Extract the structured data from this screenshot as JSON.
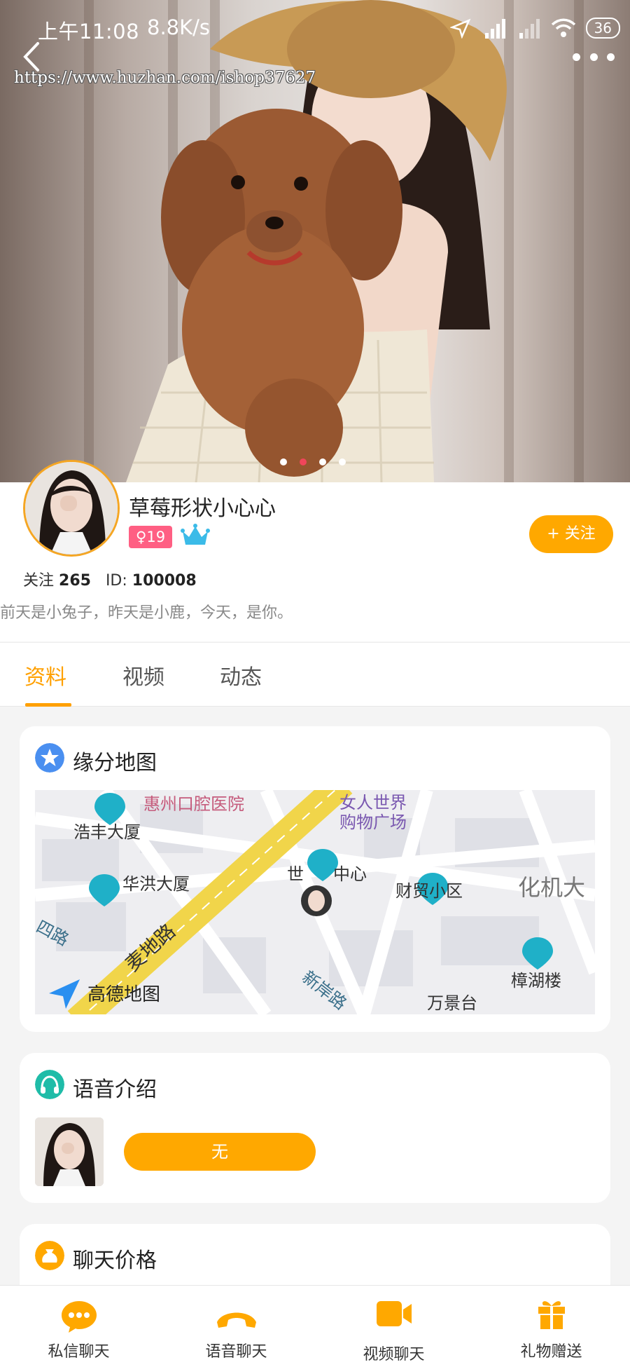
{
  "status_bar": {
    "time": "上午11:08",
    "speed": "8.8K/s",
    "battery": "36"
  },
  "watermark": "https://www.huzhan.com/ishop37627",
  "profile": {
    "nickname": "草莓形状小心心",
    "age": "19",
    "follow_button": "+ 关注",
    "follow_label": "关注",
    "follow_count": "265",
    "id_label": "ID:",
    "id_value": "100008",
    "bio": "前天是小兔子，昨天是小鹿，今天，是你。"
  },
  "tabs": [
    "资料",
    "视频",
    "动态"
  ],
  "cards": {
    "map": {
      "title": "缘分地图",
      "labels": {
        "poi1": "惠州口腔医院",
        "poi2a": "女人世界",
        "poi2b": "购物广场",
        "poi3": "浩丰大厦",
        "poi4": "华洪大厦",
        "poi5": "世",
        "poi5b": "中心",
        "poi6": "财贸小区",
        "poi7": "化机大",
        "poi8": "樟湖楼",
        "road1": "麦地路",
        "road2": "新岸路",
        "road3": "四路",
        "poi9": "万景台",
        "brand": "高德地图"
      }
    },
    "voice": {
      "title": "语音介绍",
      "button": "无"
    },
    "price": {
      "title": "聊天价格"
    }
  },
  "bottom_nav": [
    "私信聊天",
    "语音聊天",
    "视频聊天",
    "礼物赠送"
  ],
  "colors": {
    "accent": "#ffa800",
    "tab_active": "#ffa000",
    "badge": "#ff5f83",
    "indicator": "#f0455a"
  }
}
